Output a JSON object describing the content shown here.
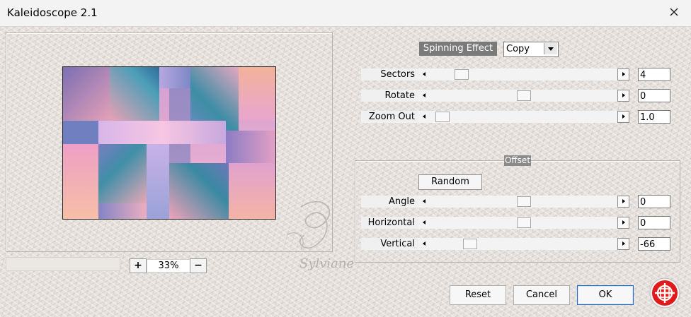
{
  "window": {
    "title": "Kaleidoscope 2.1"
  },
  "effect": {
    "label": "Spinning Effect",
    "mode": "Copy"
  },
  "params": [
    {
      "label": "Sectors",
      "value": "4",
      "level": 0.14
    },
    {
      "label": "Rotate",
      "value": "0",
      "level": 0.5
    },
    {
      "label": "Zoom Out",
      "value": "1.0",
      "level": 0.03
    }
  ],
  "offset": {
    "title": "Offset",
    "random_label": "Random",
    "params": [
      {
        "label": "Angle",
        "value": "0",
        "level": 0.5
      },
      {
        "label": "Horizontal",
        "value": "0",
        "level": 0.5
      },
      {
        "label": "Vertical",
        "value": "-66",
        "level": 0.19
      }
    ]
  },
  "zoom": {
    "plus": "+",
    "minus": "−",
    "value": "33%"
  },
  "buttons": {
    "reset": "Reset",
    "cancel": "Cancel",
    "ok": "OK"
  },
  "watermark": {
    "text": "Sylviane"
  },
  "colors": {
    "accent": "#1f6bd0",
    "label_bg": "#7a7a7a",
    "logo_red": "#e01a1a"
  }
}
